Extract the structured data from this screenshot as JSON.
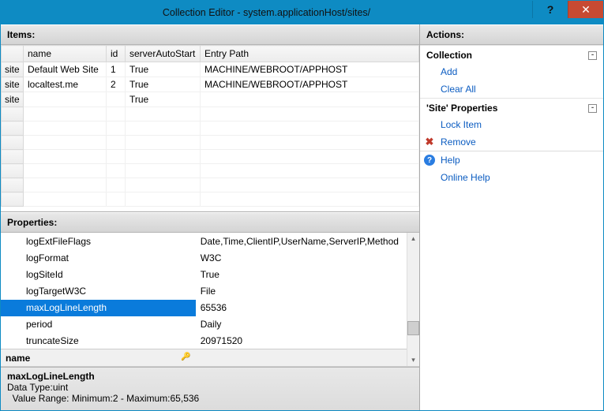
{
  "window": {
    "title": "Collection Editor - system.applicationHost/sites/",
    "help": "?",
    "close": "✕"
  },
  "items": {
    "header": "Items:",
    "columns": {
      "c0": "",
      "c1": "name",
      "c2": "id",
      "c3": "serverAutoStart",
      "c4": "Entry Path"
    },
    "rows": [
      {
        "type": "site",
        "name": "Default Web Site",
        "id": "1",
        "auto": "True",
        "path": "MACHINE/WEBROOT/APPHOST"
      },
      {
        "type": "site",
        "name": "localtest.me",
        "id": "2",
        "auto": "True",
        "path": "MACHINE/WEBROOT/APPHOST"
      },
      {
        "type": "site",
        "name": "",
        "id": "",
        "auto": "True",
        "path": ""
      }
    ]
  },
  "properties": {
    "header": "Properties:",
    "rows": [
      {
        "name": "logExtFileFlags",
        "value": "Date,Time,ClientIP,UserName,ServerIP,Method"
      },
      {
        "name": "logFormat",
        "value": "W3C"
      },
      {
        "name": "logSiteId",
        "value": "True"
      },
      {
        "name": "logTargetW3C",
        "value": "File"
      },
      {
        "name": "maxLogLineLength",
        "value": "65536",
        "selected": true
      },
      {
        "name": "period",
        "value": "Daily"
      },
      {
        "name": "truncateSize",
        "value": "20971520"
      }
    ],
    "category": "name",
    "desc": {
      "name": "maxLogLineLength",
      "type": "Data Type:uint",
      "range": "  Value Range: Minimum:2 - Maximum:65,536"
    }
  },
  "actions": {
    "header": "Actions:",
    "groups": {
      "collection": {
        "title": "Collection",
        "add": "Add",
        "clear": "Clear All"
      },
      "siteprops": {
        "title": "'Site' Properties",
        "lock": "Lock Item",
        "remove": "Remove"
      },
      "help": {
        "help": "Help",
        "online": "Online Help"
      }
    }
  }
}
